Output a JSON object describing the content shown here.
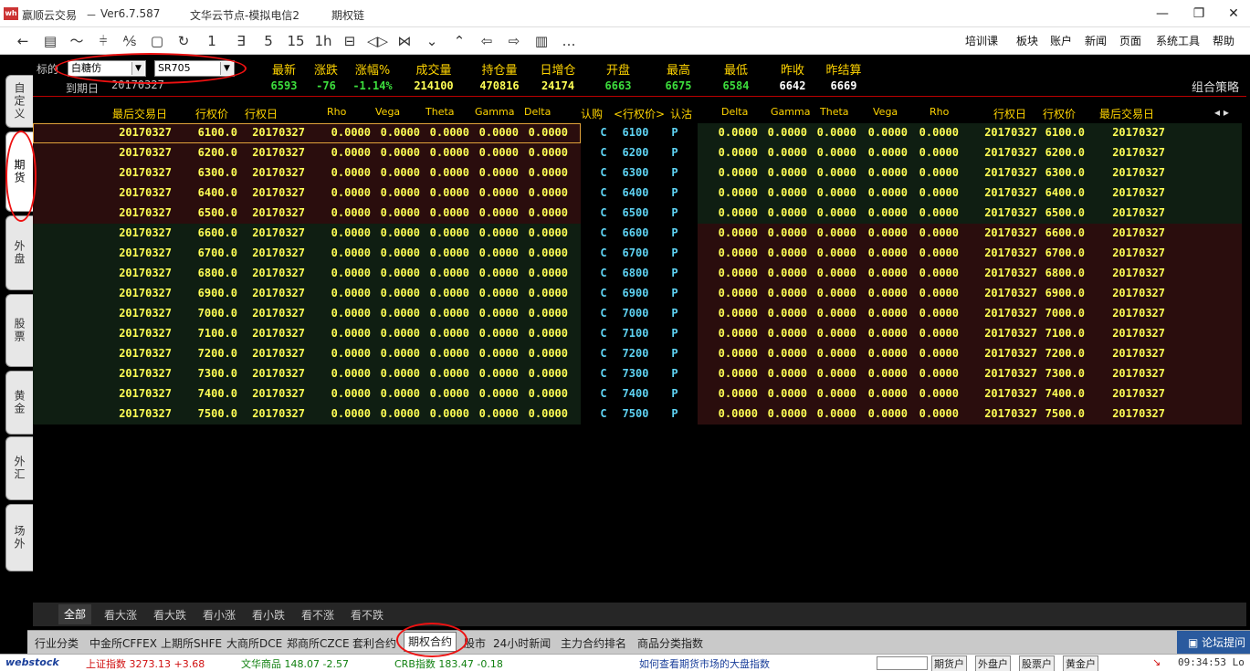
{
  "window": {
    "app_name": "赢顺云交易",
    "version": "Ver6.7.587",
    "server": "文华云节点-模拟电信2",
    "page": "期权链",
    "separator": "－",
    "minimize": "—",
    "restore": "❐",
    "close": "✕"
  },
  "toolbar": {
    "icons": [
      "←",
      "▤",
      "〜",
      "⫩",
      "⅍",
      "▢",
      "↻",
      "1",
      "∃",
      "5",
      "15",
      "1h",
      "⊟",
      "◁▷",
      "⋈",
      "⌄",
      "⌃",
      "⇦",
      "⇨",
      "▥",
      "…"
    ],
    "icon_names": [
      "back-icon",
      "list-icon",
      "line-chart-icon",
      "kline-icon",
      "formula-icon",
      "save-icon",
      "refresh-icon",
      "period-1-icon",
      "period-3-icon",
      "period-5-icon",
      "period-15-icon",
      "period-1h-icon",
      "period-day-icon",
      "zoom-icon",
      "compare-icon",
      "down-icon",
      "up-icon",
      "prev-icon",
      "next-icon",
      "layout-icon",
      "more-icon"
    ],
    "menus": [
      "培训课",
      "板块",
      "账户",
      "新闻",
      "页面",
      "系统工具",
      "帮助"
    ]
  },
  "leftnav": [
    "自定义",
    "期货",
    "外盘",
    "股票",
    "黄金",
    "外汇",
    "场外"
  ],
  "quote": {
    "underlying_label": "标的",
    "expiry_label": "到期日",
    "expiry": "20170327",
    "underlying_select": "白糖仿",
    "contract_select": "SR705",
    "columns": [
      {
        "head": "最新",
        "value": "6593",
        "color": "#3dde3d"
      },
      {
        "head": "涨跌",
        "value": "-76",
        "color": "#3dde3d"
      },
      {
        "head": "涨幅%",
        "value": "-1.14%",
        "color": "#3dde3d"
      },
      {
        "head": "成交量",
        "value": "214100",
        "color": "#ffff55"
      },
      {
        "head": "持仓量",
        "value": "470816",
        "color": "#ffff55"
      },
      {
        "head": "日增仓",
        "value": "24174",
        "color": "#ffff55"
      },
      {
        "head": "开盘",
        "value": "6663",
        "color": "#3dde3d"
      },
      {
        "head": "最高",
        "value": "6675",
        "color": "#3dde3d"
      },
      {
        "head": "最低",
        "value": "6584",
        "color": "#3dde3d"
      },
      {
        "head": "昨收",
        "value": "6642",
        "color": "#ffffff"
      },
      {
        "head": "昨结算",
        "value": "6669",
        "color": "#ffffff"
      }
    ],
    "strategy": "组合策略"
  },
  "chain": {
    "headers_left": [
      "最后交易日",
      "行权价",
      "行权日",
      "Rho",
      "Vega",
      "Theta",
      "Gamma",
      "Delta"
    ],
    "headers_mid": [
      "认购",
      "<行权价>",
      "认沽"
    ],
    "headers_right": [
      "Delta",
      "Gamma",
      "Theta",
      "Vega",
      "Rho",
      "行权日",
      "行权价",
      "最后交易日"
    ],
    "scroll_arrows": "◂ ▸",
    "date": "20170327",
    "greek": "0.0000",
    "call": "C",
    "put": "P",
    "strikes": [
      "6100",
      "6200",
      "6300",
      "6400",
      "6500",
      "6600",
      "6700",
      "6800",
      "6900",
      "7000",
      "7100",
      "7200",
      "7300",
      "7400",
      "7500"
    ],
    "strike_prices": [
      "6100.0",
      "6200.0",
      "6300.0",
      "6400.0",
      "6500.0",
      "6600.0",
      "6700.0",
      "6800.0",
      "6900.0",
      "7000.0",
      "7100.0",
      "7200.0",
      "7300.0",
      "7400.0",
      "7500.0"
    ],
    "colors": {
      "itm": "#2a0d0d",
      "otm": "#0f1e12",
      "value": "#ffff55",
      "strike": "#5ed2f2"
    }
  },
  "filters": [
    "全部",
    "看大涨",
    "看大跌",
    "看小涨",
    "看小跌",
    "看不涨",
    "看不跌"
  ],
  "bottom_tabs": [
    "行业分类",
    "中金所CFFEX",
    "上期所SHFE",
    "大商所DCE",
    "郑商所CZCE",
    "套利合约",
    "期权合约",
    "股市",
    "24小时新闻",
    "主力合约排名",
    "商品分类指数"
  ],
  "forum": "论坛提问",
  "ticker": {
    "logo": "webstock",
    "items": [
      {
        "text": "上证指数 3273.13 +3.68",
        "color": "#d01010"
      },
      {
        "text": "文华商品 148.07 -2.57",
        "color": "#108010"
      },
      {
        "text": "CRB指数 183.47 -0.18",
        "color": "#108010"
      },
      {
        "text": "如何查看期货市场的大盘指数",
        "color": "#1a3f9a"
      }
    ],
    "buttons": [
      "期货户",
      "外盘户",
      "股票户",
      "黄金户"
    ],
    "time": "09:34:53 Lo"
  }
}
